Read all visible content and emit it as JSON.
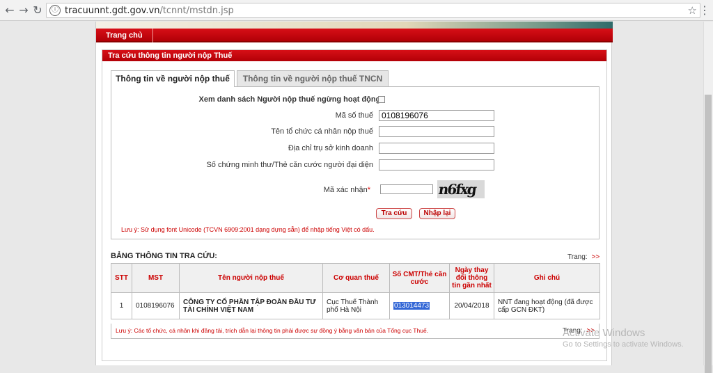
{
  "browser": {
    "url_domain": "tracuunnt.gdt.gov.vn",
    "url_path": "/tcnnt/mstdn.jsp",
    "info_icon": "ⓘ"
  },
  "topnav": {
    "home": "Trang chủ"
  },
  "panel": {
    "title": "Tra cứu thông tin người nộp Thuế"
  },
  "tabs": {
    "active": "Thông tin về người nộp thuế",
    "inactive": "Thông tin về người nộp thuế TNCN"
  },
  "form": {
    "inactive_list_label": "Xem danh sách Người nộp thuế ngừng hoạt động:",
    "mst_label": "Mã số thuế",
    "mst_value": "0108196076",
    "name_label": "Tên tổ chức cá nhân nộp thuế",
    "address_label": "Địa chỉ trụ sở kinh doanh",
    "id_label": "Số chứng minh thư/Thẻ căn cước người đại diện",
    "captcha_label": "Mã xác nhận",
    "captcha_required": "*",
    "captcha_text": "n6fxg",
    "search_button": "Tra cứu",
    "reset_button": "Nhập lại",
    "note": "Lưu ý: Sử dụng font Unicode (TCVN 6909:2001 dạng dựng sẵn) để nhập tiếng Việt có dấu."
  },
  "results": {
    "title": "BẢNG THÔNG TIN TRA CỨU:",
    "page_label": "Trang:",
    "page_next": ">>",
    "columns": [
      "STT",
      "MST",
      "Tên người nộp thuế",
      "Cơ quan thuế",
      "Số CMT/Thẻ căn cước",
      "Ngày thay đổi thông tin gần nhất",
      "Ghi chú"
    ],
    "rows": [
      {
        "stt": "1",
        "mst": "0108196076",
        "name": "CÔNG TY CỔ PHẦN TẬP ĐOÀN ĐẦU TƯ TÀI CHÍNH VIỆT NAM",
        "agency": "Cục Thuế Thành phố Hà Nội",
        "id_number": "013014473",
        "date": "20/04/2018",
        "note": "NNT đang hoạt động (đã được cấp GCN ĐKT)"
      }
    ],
    "footer_note": "Lưu ý: Các tổ chức, cá nhân khi đăng tải, trích dẫn lại thông tin phải được sự đồng ý bằng văn bản của Tổng cục Thuế.",
    "footer_page_label": "Trang:",
    "footer_page_next": ">>"
  },
  "watermark": {
    "line1": "Activate Windows",
    "line2": "Go to Settings to activate Windows."
  }
}
